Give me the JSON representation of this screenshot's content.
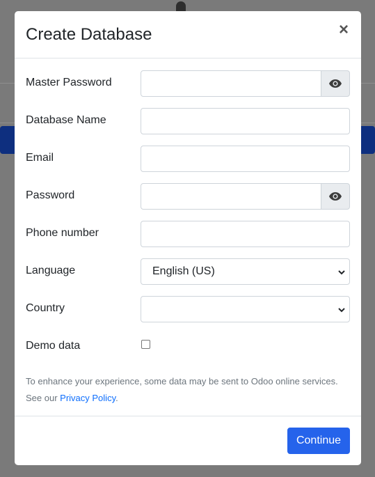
{
  "dialog": {
    "title": "Create Database",
    "close_label": "×"
  },
  "fields": {
    "master_password": {
      "label": "Master Password",
      "value": ""
    },
    "database_name": {
      "label": "Database Name",
      "value": ""
    },
    "email": {
      "label": "Email",
      "value": ""
    },
    "password": {
      "label": "Password",
      "value": ""
    },
    "phone": {
      "label": "Phone number",
      "value": ""
    },
    "language": {
      "label": "Language",
      "selected": "English (US)"
    },
    "country": {
      "label": "Country",
      "selected": ""
    },
    "demo_data": {
      "label": "Demo data",
      "checked": false
    }
  },
  "notice": {
    "text_line1": "To enhance your experience, some data may be sent to Odoo online services.",
    "text_prefix": "See our ",
    "link_label": "Privacy Policy",
    "text_suffix": "."
  },
  "footer": {
    "continue_label": "Continue"
  },
  "icons": {
    "show_password": "eye-icon",
    "dropdown": "chevron-down-icon"
  },
  "colors": {
    "primary": "#2563eb",
    "overlay": "#7a7a7a",
    "link": "#0d6efd"
  }
}
